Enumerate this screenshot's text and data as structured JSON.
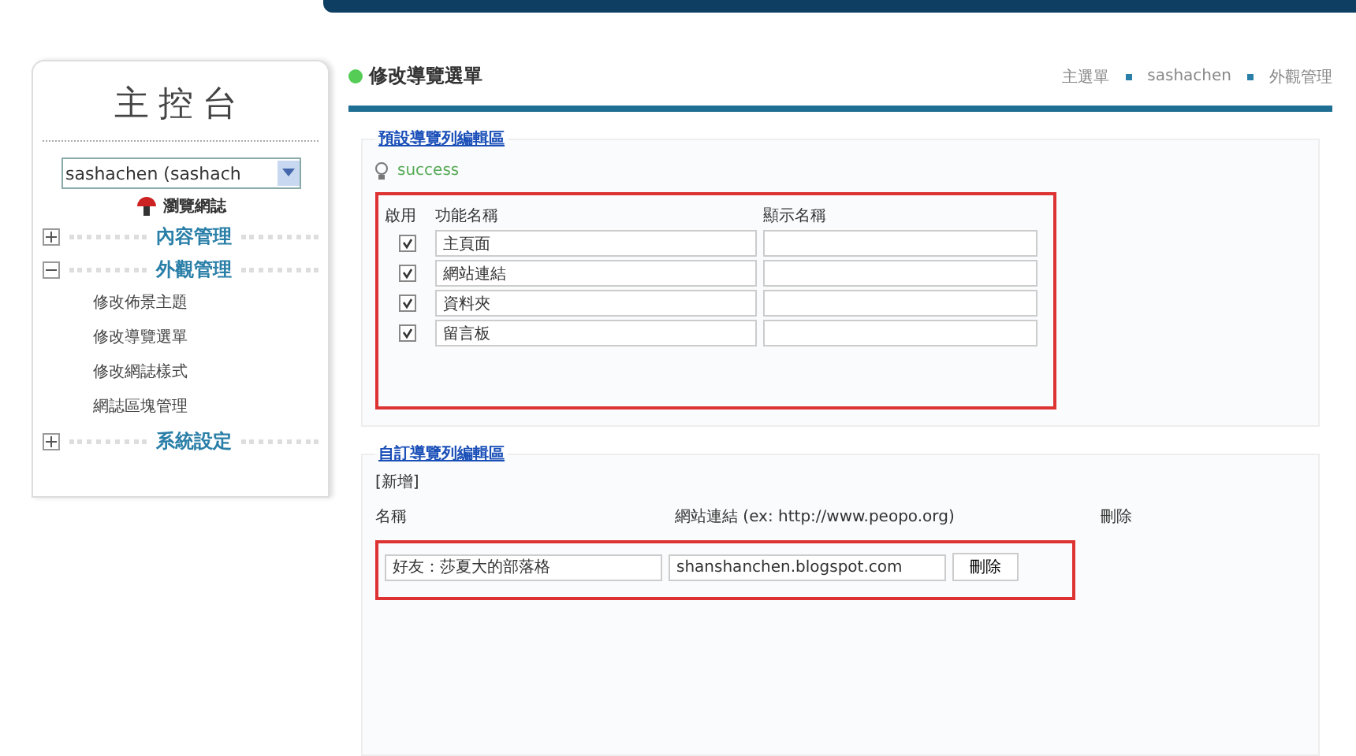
{
  "sidebar": {
    "title": "主控台",
    "account_select": {
      "value": "sashachen (sashach"
    },
    "view_link": "瀏覽網誌",
    "menu": [
      {
        "label": "內容管理",
        "expanded": false
      },
      {
        "label": "外觀管理",
        "expanded": true,
        "children": [
          {
            "label": "修改佈景主題"
          },
          {
            "label": "修改導覽選單"
          },
          {
            "label": "修改網誌樣式"
          },
          {
            "label": "網誌區塊管理"
          }
        ]
      },
      {
        "label": "系統設定",
        "expanded": false
      }
    ]
  },
  "page": {
    "title": "修改導覽選單",
    "breadcrumb": [
      "主選單",
      "sashachen",
      "外觀管理"
    ]
  },
  "default_nav": {
    "legend": "預設導覽列編輯區",
    "message": "success",
    "columns": [
      "啟用",
      "功能名稱",
      "顯示名稱"
    ],
    "rows": [
      {
        "enabled": true,
        "name": "主頁面"
      },
      {
        "enabled": true,
        "name": "網站連結"
      },
      {
        "enabled": true,
        "name": "資料夾"
      },
      {
        "enabled": true,
        "name": "留言板"
      }
    ]
  },
  "custom_nav": {
    "legend": "自訂導覽列編輯區",
    "add_link": "[新增]",
    "columns": [
      "名稱",
      "網站連結 (ex: http://www.peopo.org)",
      "刪除"
    ],
    "rows": [
      {
        "name": "好友：莎夏大的部落格",
        "url": "shanshanchen.blogspot.com",
        "delete": "刪除"
      }
    ]
  }
}
